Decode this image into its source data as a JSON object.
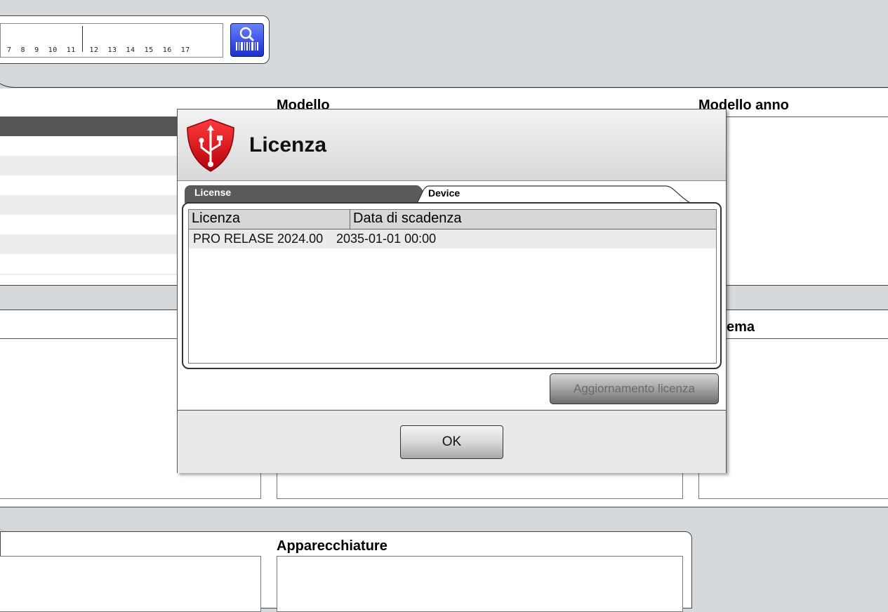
{
  "background": {
    "vin_scale": "7  8  9  10  11   12  13  14  15  16  17",
    "headers": {
      "modello": "Modello",
      "modello_anno": "Modello anno",
      "sistema_partial": "ema",
      "apparecchiature": "Apparecchiature"
    }
  },
  "dialog": {
    "title": "Licenza",
    "tabs": [
      {
        "label": "License",
        "active": true
      },
      {
        "label": "Device",
        "active": false
      }
    ],
    "grid": {
      "columns": [
        "Licenza",
        "Data di scadenza"
      ],
      "rows": [
        {
          "licenza": "PRO RELASE 2024.00",
          "scadenza": "2035-01-01 00:00"
        }
      ]
    },
    "update_button": "Aggiornamento licenza",
    "ok_button": "OK"
  },
  "colors": {
    "shield_red": "#d8101f",
    "scan_blue": "#2c44e8",
    "tab_active": "#5a5a5a"
  }
}
